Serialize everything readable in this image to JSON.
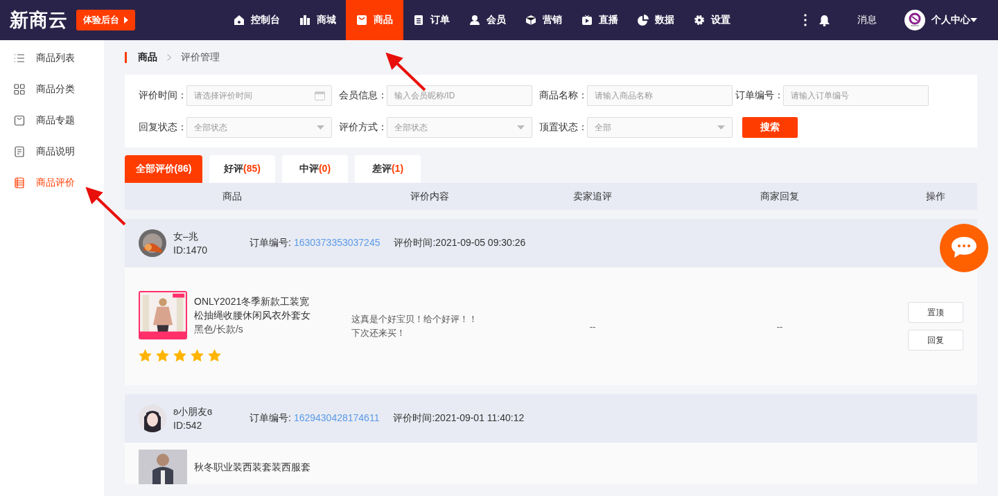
{
  "header": {
    "logo": "新商云",
    "trial_button": "体验后台",
    "nav": [
      {
        "label": "控制台",
        "selected": false
      },
      {
        "label": "商城",
        "selected": false
      },
      {
        "label": "商品",
        "selected": true
      },
      {
        "label": "订单",
        "selected": false
      },
      {
        "label": "会员",
        "selected": false
      },
      {
        "label": "营销",
        "selected": false
      },
      {
        "label": "直播",
        "selected": false
      },
      {
        "label": "数据",
        "selected": false
      },
      {
        "label": "设置",
        "selected": false
      }
    ],
    "messages": "消息",
    "user_menu": "个人中心"
  },
  "sidebar": {
    "items": [
      {
        "label": "商品列表",
        "selected": false
      },
      {
        "label": "商品分类",
        "selected": false
      },
      {
        "label": "商品专题",
        "selected": false
      },
      {
        "label": "商品说明",
        "selected": false
      },
      {
        "label": "商品评价",
        "selected": true
      }
    ]
  },
  "breadcrumb": [
    "商品",
    "评价管理"
  ],
  "filters": [
    {
      "label": "评价时间：",
      "kind": "date",
      "placeholder": "请选择评价时间"
    },
    {
      "label": "会员信息：",
      "kind": "text",
      "placeholder": "输入会员昵称/ID"
    },
    {
      "label": "商品名称：",
      "kind": "text",
      "placeholder": "请输入商品名称"
    },
    {
      "label": "订单编号：",
      "kind": "text",
      "placeholder": "请输入订单编号"
    },
    {
      "label": "回复状态：",
      "kind": "select",
      "value": "全部状态"
    },
    {
      "label": "评价方式：",
      "kind": "select",
      "value": "全部状态"
    },
    {
      "label": "顶置状态：",
      "kind": "select",
      "value": "全部"
    }
  ],
  "search_button": "搜索",
  "tabs": [
    {
      "label": "全部评价",
      "count": "(86)",
      "selected": true
    },
    {
      "label": "好评",
      "count": "(85)",
      "selected": false
    },
    {
      "label": "中评",
      "count": "(0)",
      "selected": false
    },
    {
      "label": "差评",
      "count": "(1)",
      "selected": false
    }
  ],
  "table": {
    "columns": [
      "商品",
      "评价内容",
      "卖家追评",
      "商家回复",
      "操作"
    ],
    "reviews": [
      {
        "member": "女–兆",
        "member_id": "ID:1470",
        "order_label": "订单编号:",
        "order_no": "1630373353037245",
        "time": "评价时间:2021-09-05 09:30:26",
        "product": "ONLY2021冬季新款工装宽松抽绳收腰休闲风衣外套女",
        "spec": "黑色/长款/s",
        "stars": 5,
        "content": "这真是个好宝贝！给个好评！！下次还来买！",
        "followup": "--",
        "reply": "--",
        "actions": [
          "置顶",
          "回复"
        ]
      },
      {
        "member": "ʚ小朋友ɞ",
        "member_id": "ID:542",
        "order_label": "订单编号:",
        "order_no": "1629430428174611",
        "time": "评价时间:2021-09-01 11:40:12",
        "product": "秋冬职业装西装套装西服套"
      }
    ]
  }
}
